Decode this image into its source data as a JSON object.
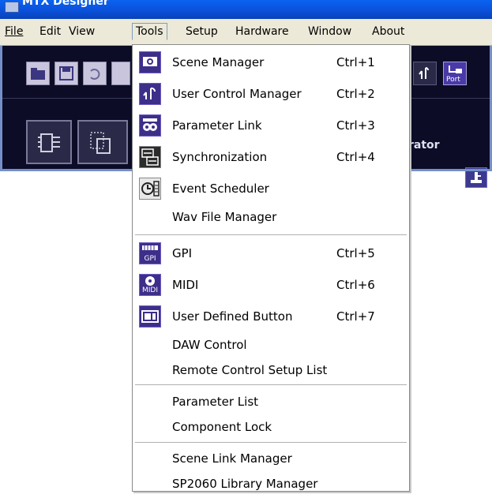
{
  "window": {
    "title": "MTX Designer"
  },
  "menubar": {
    "items": [
      {
        "label": "File",
        "active": false
      },
      {
        "label": "Edit",
        "active": false
      },
      {
        "label": "View",
        "active": false
      },
      {
        "label": "Tools",
        "active": true
      },
      {
        "label": "Setup",
        "active": false
      },
      {
        "label": "Hardware",
        "active": false
      },
      {
        "label": "Window",
        "active": false
      },
      {
        "label": "About",
        "active": false
      }
    ]
  },
  "toolbar": {
    "port_label": "Port",
    "generator_fragment": "rator"
  },
  "tools_menu": {
    "items": [
      {
        "label": "Scene Manager",
        "shortcut": "Ctrl+1",
        "icon": "scene-manager-icon"
      },
      {
        "label": "User Control Manager",
        "shortcut": "Ctrl+2",
        "icon": "user-control-icon"
      },
      {
        "label": "Parameter Link",
        "shortcut": "Ctrl+3",
        "icon": "parameter-link-icon"
      },
      {
        "label": "Synchronization",
        "shortcut": "Ctrl+4",
        "icon": "synchronization-icon"
      },
      {
        "label": "Event Scheduler",
        "shortcut": "",
        "icon": "event-scheduler-icon"
      },
      {
        "label": "Wav File Manager",
        "shortcut": "",
        "icon": ""
      },
      {
        "label": "GPI",
        "shortcut": "Ctrl+5",
        "icon": "gpi-icon",
        "icon_text": "GPI"
      },
      {
        "label": "MIDI",
        "shortcut": "Ctrl+6",
        "icon": "midi-icon",
        "icon_text": "MIDI"
      },
      {
        "label": "User Defined Button",
        "shortcut": "Ctrl+7",
        "icon": "user-defined-button-icon"
      },
      {
        "label": "DAW Control",
        "shortcut": "",
        "icon": ""
      },
      {
        "label": "Remote Control Setup List",
        "shortcut": "",
        "icon": ""
      },
      {
        "label": "Parameter List",
        "shortcut": "",
        "icon": ""
      },
      {
        "label": "Component Lock",
        "shortcut": "",
        "icon": ""
      },
      {
        "label": "Scene Link Manager",
        "shortcut": "",
        "icon": ""
      },
      {
        "label": "SP2060 Library Manager",
        "shortcut": "",
        "icon": ""
      }
    ]
  },
  "colors": {
    "titlebar": "#0a4fd8",
    "menubar_bg": "#ece9d8",
    "toolbar_bg": "#0c0c26",
    "icon_purple": "#3d2e8a"
  }
}
